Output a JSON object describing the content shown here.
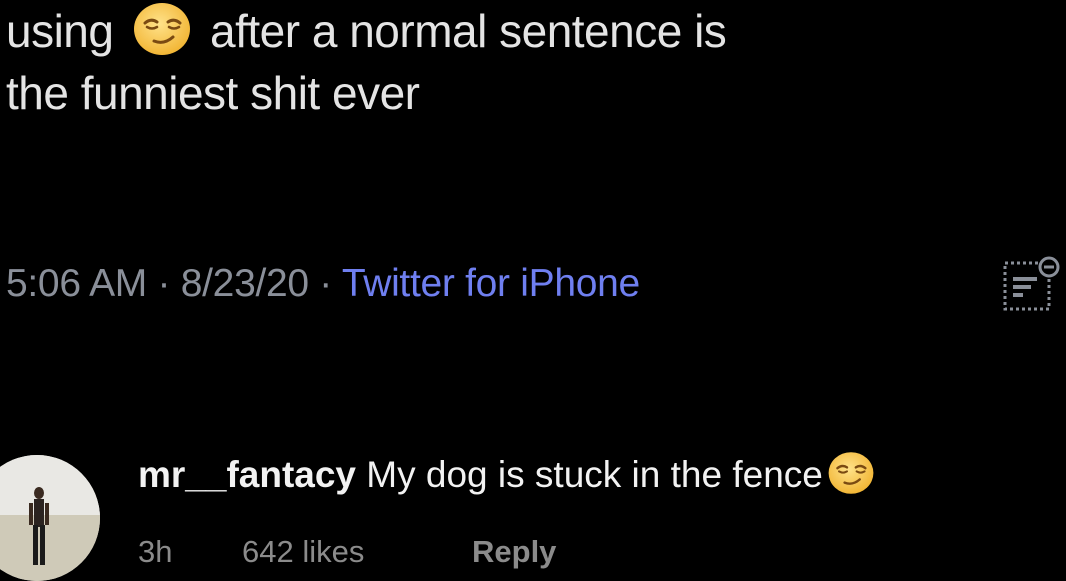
{
  "tweet": {
    "text_before_emoji": "using",
    "text_after_emoji": "after a normal sentence is",
    "text_line2": "the funniest shit ever",
    "emoji_icon": "smirking-face-emoji",
    "timestamp": "5:06 AM · 8/23/20 · ",
    "source": "Twitter for iPhone",
    "analytics_icon": "analytics-icon",
    "colors": {
      "background": "#000000",
      "text": "#e4e4e4",
      "meta": "#8a8f99",
      "source_link": "#6f7ff0"
    }
  },
  "comment": {
    "username": "mr__fantacy",
    "text": "My dog is stuck in the fence",
    "emoji_icon": "smirking-face-emoji",
    "time": "3h",
    "likes": "642 likes",
    "reply_label": "Reply"
  }
}
